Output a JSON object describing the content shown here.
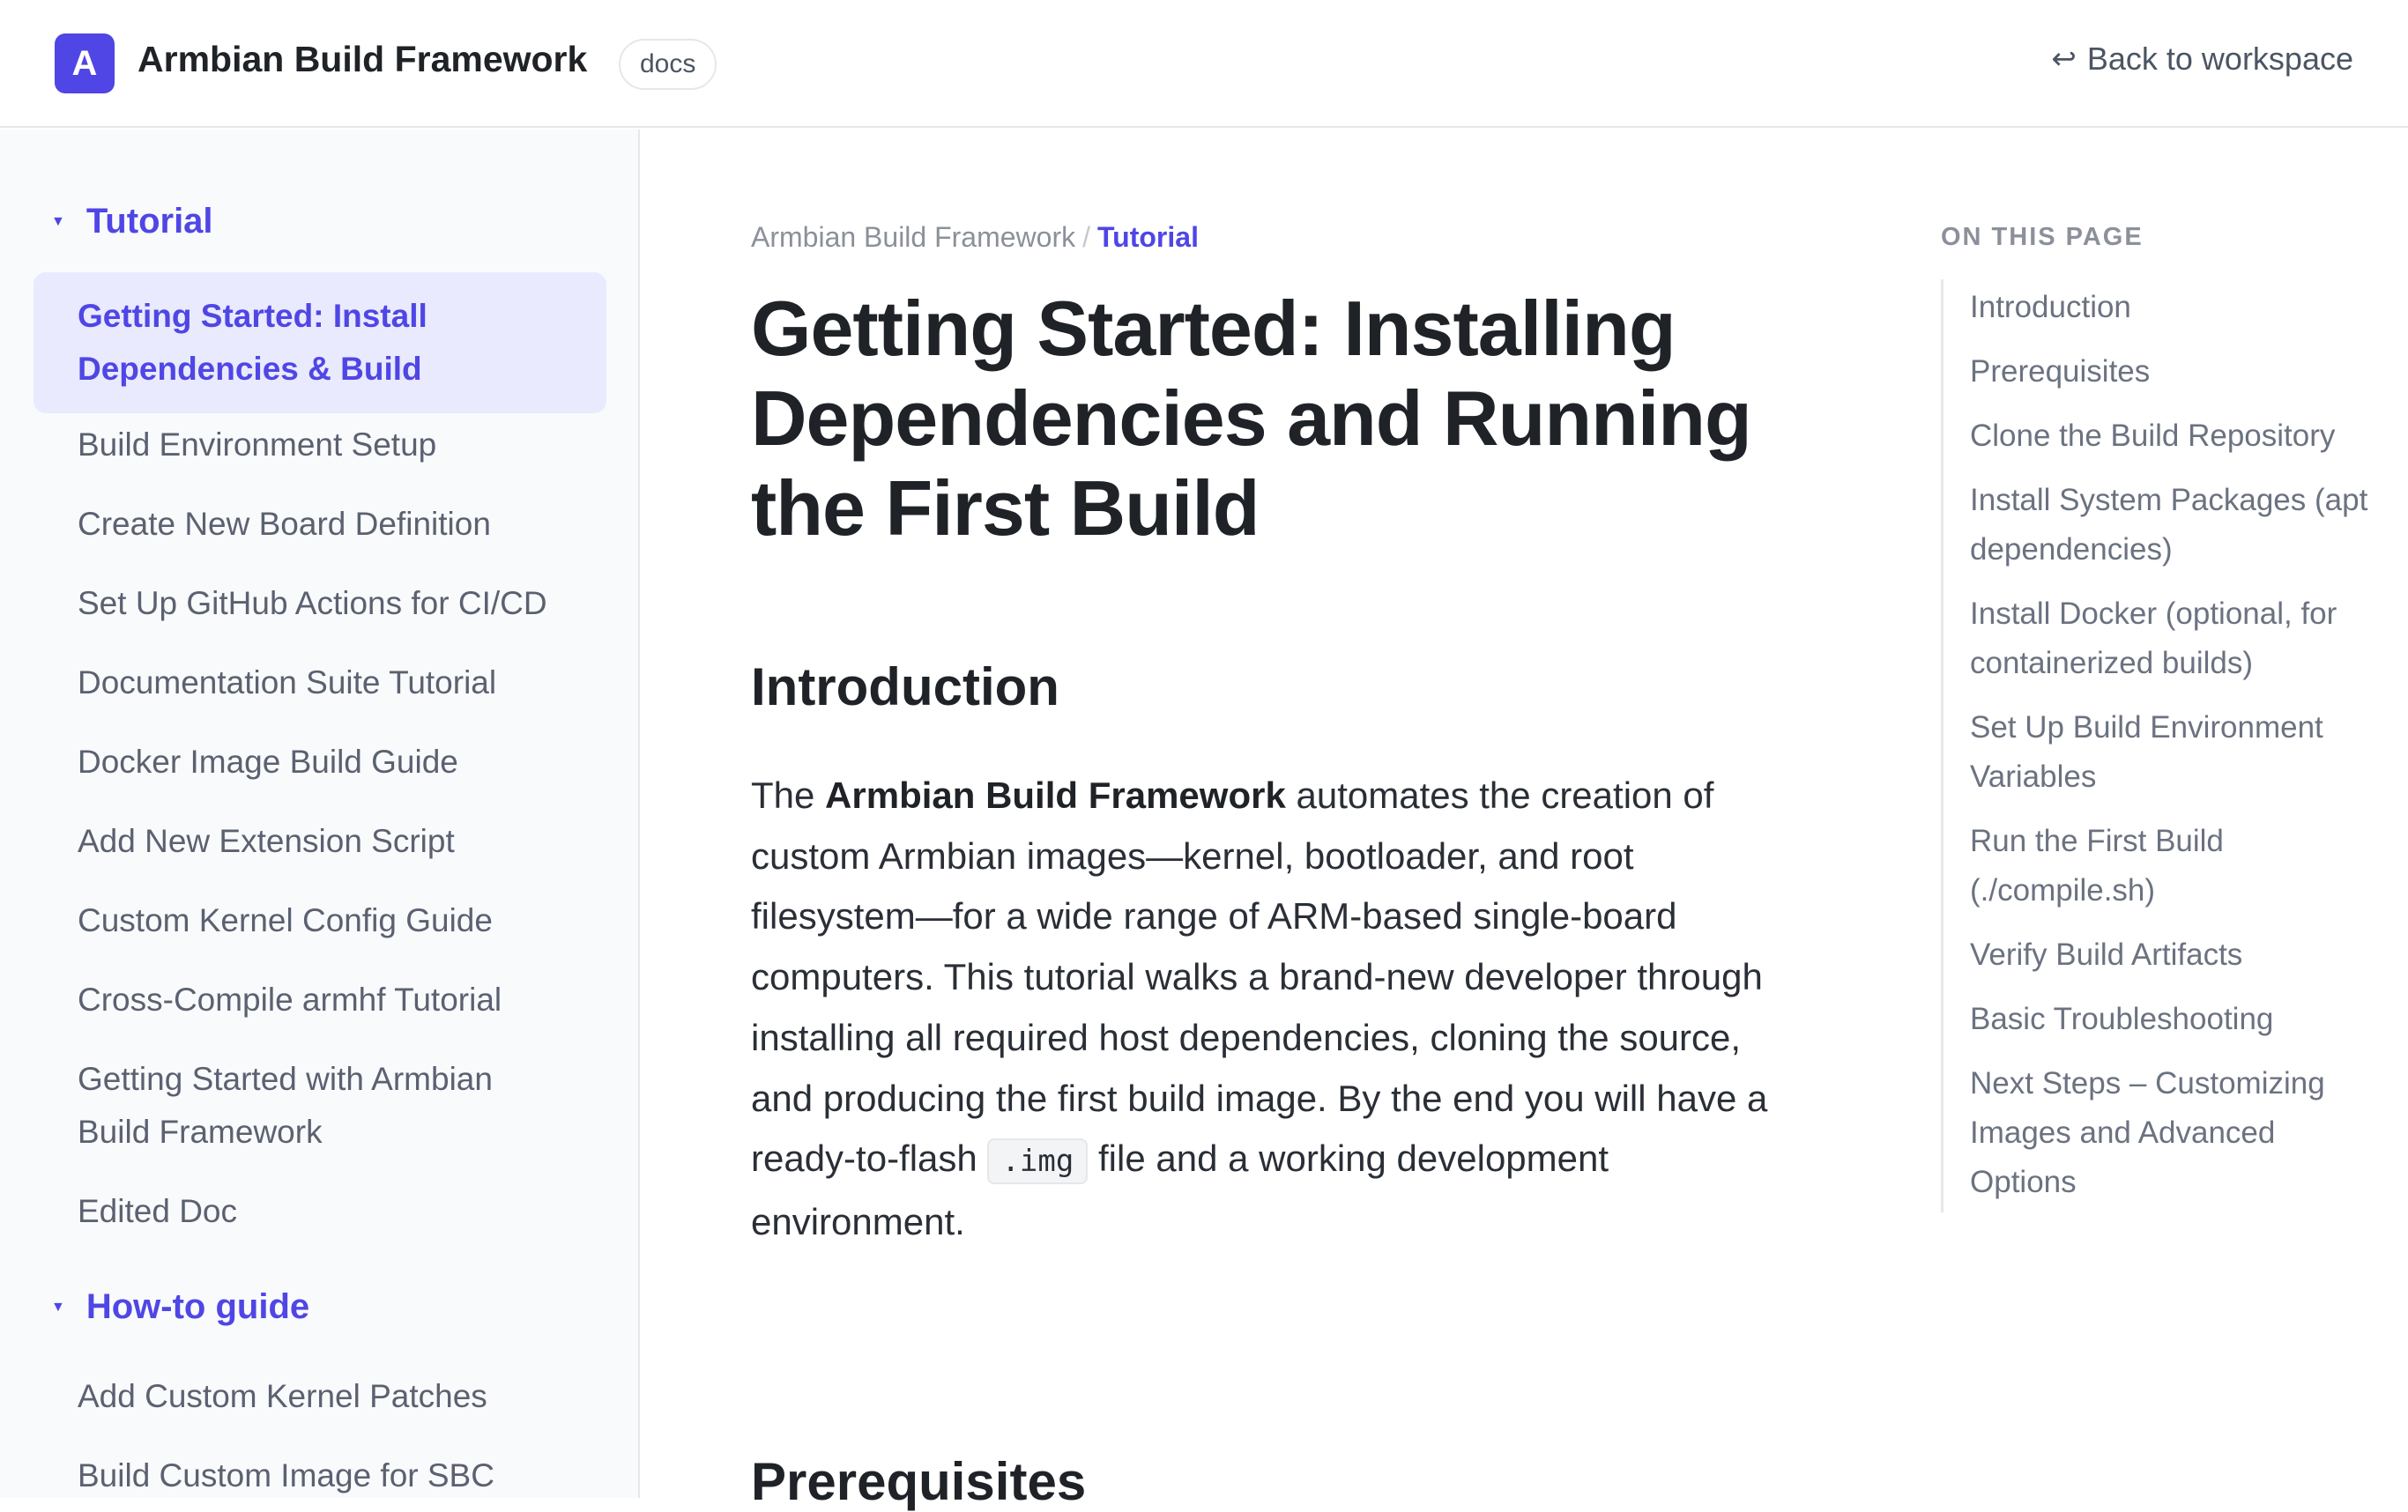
{
  "header": {
    "logo_letter": "A",
    "title": "Armbian Build Framework",
    "badge": "docs",
    "back_arrow": "↩",
    "back_label": "Back to workspace"
  },
  "sidebar": {
    "sections": [
      {
        "label": "Tutorial",
        "icon": "triangle-down-icon"
      },
      {
        "label": "How-to guide",
        "icon": "triangle-down-icon"
      }
    ],
    "tutorial_items": [
      "Getting Started: Install Dependencies & Build",
      "Build Environment Setup",
      "Create New Board Definition",
      "Set Up GitHub Actions for CI/CD",
      "Documentation Suite Tutorial",
      "Docker Image Build Guide",
      "Add New Extension Script",
      "Custom Kernel Config Guide",
      "Cross-Compile armhf Tutorial",
      "Getting Started with Armbian Build Framework",
      "Edited Doc"
    ],
    "howto_items": [
      "Add Custom Kernel Patches",
      "Build Custom Image for SBC"
    ]
  },
  "main": {
    "breadcrumb": {
      "root": "Armbian Build Framework",
      "sep": "/",
      "current": "Tutorial"
    },
    "title": "Getting Started: Installing Dependencies and Running the First Build",
    "intro_heading": "Introduction",
    "intro": {
      "p1": "The ",
      "bold": "Armbian Build Framework",
      "p2": " automates the creation of custom Armbian images—kernel, bootloader, and root filesystem—for a wide range of ARM-based single-board computers. This tutorial walks a brand-new developer through installing all required host dependencies, cloning the source, and producing the first build image. By the end you will have a ready-to-flash ",
      "code": ".img",
      "p3": " file and a working development environment."
    },
    "prereq_heading": "Prerequisites"
  },
  "toc": {
    "title": "ON THIS PAGE",
    "items": [
      "Introduction",
      "Prerequisites",
      "Clone the Build Repository",
      "Install System Packages (apt dependencies)",
      "Install Docker (optional, for containerized builds)",
      "Set Up Build Environment Variables",
      "Run the First Build (./compile.sh)",
      "Verify Build Artifacts",
      "Basic Troubleshooting",
      "Next Steps – Customizing Images and Advanced Options"
    ]
  }
}
